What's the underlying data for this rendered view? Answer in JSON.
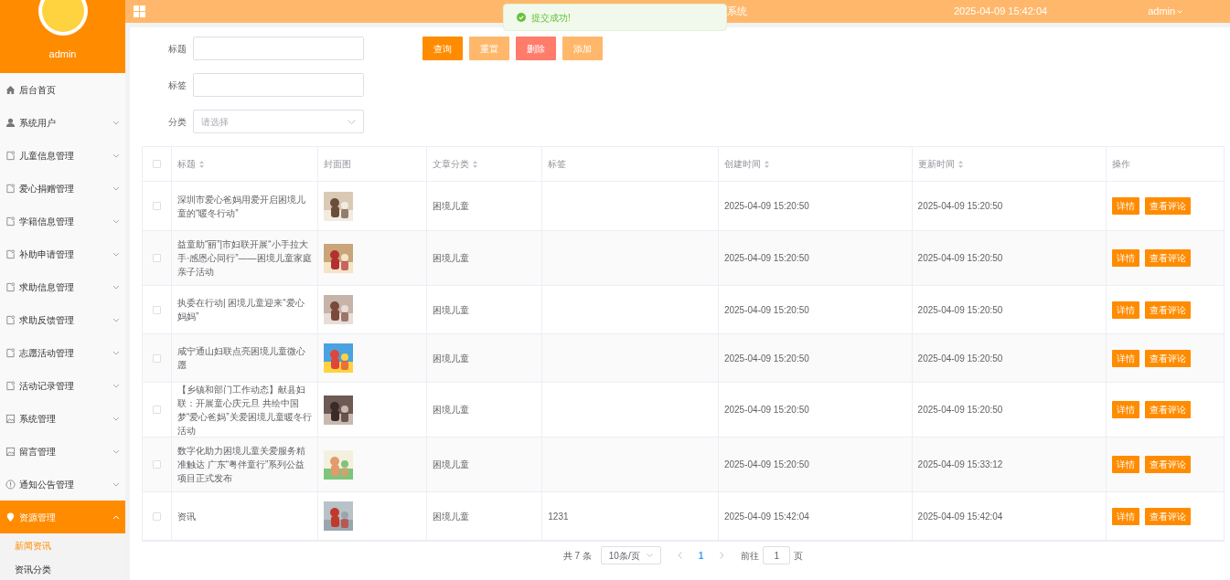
{
  "sidebar": {
    "user": "admin",
    "items": [
      {
        "label": "后台首页",
        "selected": false
      },
      {
        "label": "系统用户",
        "expanded": false,
        "selected": false
      },
      {
        "label": "儿童信息管理",
        "expanded": false,
        "selected": false
      },
      {
        "label": "爱心捐赠管理",
        "expanded": false,
        "selected": false
      },
      {
        "label": "学籍信息管理",
        "expanded": false,
        "selected": false
      },
      {
        "label": "补助申请管理",
        "expanded": false,
        "selected": false
      },
      {
        "label": "求助信息管理",
        "expanded": false,
        "selected": false
      },
      {
        "label": "求助反馈管理",
        "expanded": false,
        "selected": false
      },
      {
        "label": "志愿活动管理",
        "expanded": false,
        "selected": false
      },
      {
        "label": "活动记录管理",
        "expanded": false,
        "selected": false
      },
      {
        "label": "系统管理",
        "expanded": false,
        "selected": false
      },
      {
        "label": "留言管理",
        "expanded": false,
        "selected": false
      },
      {
        "label": "通知公告管理",
        "expanded": false,
        "selected": false
      },
      {
        "label": "资源管理",
        "selected": true,
        "expanded": true,
        "children": [
          {
            "label": "新闻资讯",
            "selected": true
          },
          {
            "label": "资讯分类",
            "selected": false
          }
        ]
      }
    ]
  },
  "header": {
    "title": "系统",
    "datetime": "2025-04-09 15:42:04",
    "user": "admin"
  },
  "toast": {
    "message": "提交成功!"
  },
  "filters": [
    {
      "kind": "input",
      "label": "标题"
    },
    {
      "kind": "input",
      "label": "标签"
    },
    {
      "kind": "select",
      "label": "分类",
      "placeholder": "请选择"
    }
  ],
  "buttons": [
    {
      "label": "查询",
      "kind": "primary"
    },
    {
      "label": "重置",
      "kind": "light"
    },
    {
      "label": "删除",
      "kind": "danger"
    },
    {
      "label": "添加",
      "kind": "light"
    }
  ],
  "table": {
    "all_checked": false,
    "columns": [
      {
        "label": "标题",
        "sortable": true
      },
      {
        "label": "封面图",
        "sortable": false
      },
      {
        "label": "文章分类",
        "sortable": true
      },
      {
        "label": "标签",
        "sortable": false
      },
      {
        "label": "创建时间",
        "sortable": true
      },
      {
        "label": "更新时间",
        "sortable": true
      },
      {
        "label": "操作",
        "sortable": false
      }
    ],
    "rows": [
      {
        "checked": false,
        "title": "深圳市爱心爸妈用爱开启困境儿童的“暖冬行动”",
        "category": "困境儿童",
        "tag": "",
        "created": "2025-04-09 15:20:50",
        "updated": "2025-04-09 15:20:50",
        "actions": [
          "详情",
          "查看评论"
        ]
      },
      {
        "checked": false,
        "title": "益童助“丽”|市妇联开展“小手拉大手·感恩心同行”——困境儿童家庭亲子活动",
        "category": "困境儿童",
        "tag": "",
        "created": "2025-04-09 15:20:50",
        "updated": "2025-04-09 15:20:50",
        "actions": [
          "详情",
          "查看评论"
        ]
      },
      {
        "checked": false,
        "title": "执委在行动| 困境儿童迎来“爱心妈妈”",
        "category": "困境儿童",
        "tag": "",
        "created": "2025-04-09 15:20:50",
        "updated": "2025-04-09 15:20:50",
        "actions": [
          "详情",
          "查看评论"
        ]
      },
      {
        "checked": false,
        "title": "咸宁通山妇联点亮困境儿童微心愿",
        "category": "困境儿童",
        "tag": "",
        "created": "2025-04-09 15:20:50",
        "updated": "2025-04-09 15:20:50",
        "actions": [
          "详情",
          "查看评论"
        ]
      },
      {
        "checked": false,
        "title": "【乡镇和部门工作动态】献县妇联：开展童心庆元旦 共绘中国梦“爱心爸妈”关爱困境儿童暖冬行活动",
        "category": "困境儿童",
        "tag": "",
        "created": "2025-04-09 15:20:50",
        "updated": "2025-04-09 15:20:50",
        "actions": [
          "详情",
          "查看评论"
        ]
      },
      {
        "checked": false,
        "title": "数字化助力困境儿童关爱服务精准触达 广东“粤伴童行”系列公益项目正式发布",
        "category": "困境儿童",
        "tag": "",
        "created": "2025-04-09 15:20:50",
        "updated": "2025-04-09 15:33:12",
        "actions": [
          "详情",
          "查看评论"
        ]
      },
      {
        "checked": false,
        "title": "资讯",
        "category": "困境儿童",
        "tag": "1231",
        "created": "2025-04-09 15:42:04",
        "updated": "2025-04-09 15:42:04",
        "actions": [
          "详情",
          "查看评论"
        ]
      }
    ]
  },
  "pagination": {
    "total": "共 7 条",
    "page_size": "10条/页",
    "pages": [
      {
        "label": "1",
        "selected": true
      }
    ],
    "goto_label": "前往",
    "goto_value": "1",
    "page_suffix": "页"
  }
}
